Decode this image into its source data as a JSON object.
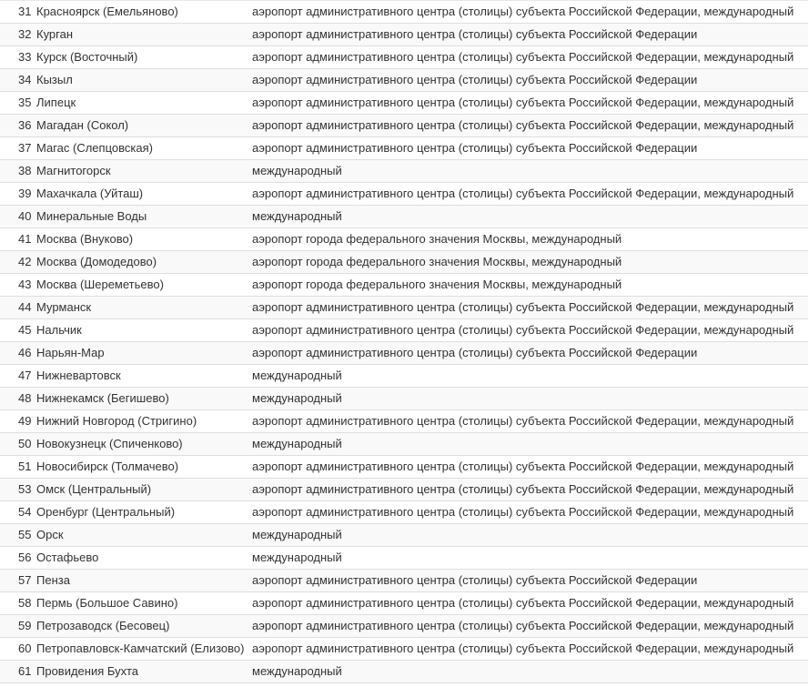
{
  "rows": [
    {
      "num": "31",
      "name": "Красноярск (Емельяново)",
      "status": "аэропорт административного центра (столицы) субъекта Российской Федерации, международный"
    },
    {
      "num": "32",
      "name": "Курган",
      "status": "аэропорт административного центра (столицы) субъекта Российской Федерации"
    },
    {
      "num": "33",
      "name": "Курск (Восточный)",
      "status": "аэропорт административного центра (столицы) субъекта Российской Федерации, международный"
    },
    {
      "num": "34",
      "name": "Кызыл",
      "status": "аэропорт административного центра (столицы) субъекта Российской Федерации"
    },
    {
      "num": "35",
      "name": "Липецк",
      "status": "аэропорт административного центра (столицы) субъекта Российской Федерации, международный"
    },
    {
      "num": "36",
      "name": "Магадан (Сокол)",
      "status": "аэропорт административного центра (столицы) субъекта Российской Федерации, международный"
    },
    {
      "num": "37",
      "name": "Магас (Слепцовская)",
      "status": "аэропорт административного центра (столицы) субъекта Российской Федерации"
    },
    {
      "num": "38",
      "name": "Магнитогорск",
      "status": "международный"
    },
    {
      "num": "39",
      "name": "Махачкала (Уйташ)",
      "status": "аэропорт административного центра (столицы) субъекта Российской Федерации, международный"
    },
    {
      "num": "40",
      "name": "Минеральные Воды",
      "status": "международный"
    },
    {
      "num": "41",
      "name": "Москва (Внуково)",
      "status": "аэропорт города федерального значения Москвы, международный"
    },
    {
      "num": "42",
      "name": "Москва (Домодедово)",
      "status": "аэропорт города федерального значения Москвы, международный"
    },
    {
      "num": "43",
      "name": "Москва (Шереметьево)",
      "status": "аэропорт города федерального значения Москвы, международный"
    },
    {
      "num": "44",
      "name": "Мурманск",
      "status": "аэропорт административного центра (столицы) субъекта Российской Федерации, международный"
    },
    {
      "num": "45",
      "name": "Нальчик",
      "status": "аэропорт административного центра (столицы) субъекта Российской Федерации, международный"
    },
    {
      "num": "46",
      "name": "Нарьян-Мар",
      "status": "аэропорт административного центра (столицы) субъекта Российской Федерации"
    },
    {
      "num": "47",
      "name": "Нижневартовск",
      "status": "международный"
    },
    {
      "num": "48",
      "name": "Нижнекамск (Бегишево)",
      "status": "международный"
    },
    {
      "num": "49",
      "name": "Нижний Новгород (Стригино)",
      "status": "аэропорт административного центра (столицы) субъекта Российской Федерации, международный"
    },
    {
      "num": "50",
      "name": "Новокузнецк (Спиченково)",
      "status": "международный"
    },
    {
      "num": "51",
      "name": "Новосибирск (Толмачево)",
      "status": "аэропорт административного центра (столицы) субъекта Российской Федерации, международный"
    },
    {
      "num": "53",
      "name": "Омск (Центральный)",
      "status": "аэропорт административного центра (столицы) субъекта Российской Федерации, международный"
    },
    {
      "num": "54",
      "name": "Оренбург (Центральный)",
      "status": "аэропорт административного центра (столицы) субъекта Российской Федерации, международный"
    },
    {
      "num": "55",
      "name": "Орск",
      "status": "международный"
    },
    {
      "num": "56",
      "name": "Остафьево",
      "status": "международный"
    },
    {
      "num": "57",
      "name": "Пенза",
      "status": "аэропорт административного центра (столицы) субъекта Российской Федерации"
    },
    {
      "num": "58",
      "name": "Пермь (Большое Савино)",
      "status": "аэропорт административного центра (столицы) субъекта Российской Федерации, международный"
    },
    {
      "num": "59",
      "name": "Петрозаводск (Бесовец)",
      "status": "аэропорт административного центра (столицы) субъекта Российской Федерации, международный"
    },
    {
      "num": "60",
      "name": "Петропавловск-Камчатский (Елизово)",
      "status": "аэропорт административного центра (столицы) субъекта Российской Федерации, международный"
    },
    {
      "num": "61",
      "name": "Провидения Бухта",
      "status": "международный"
    }
  ]
}
